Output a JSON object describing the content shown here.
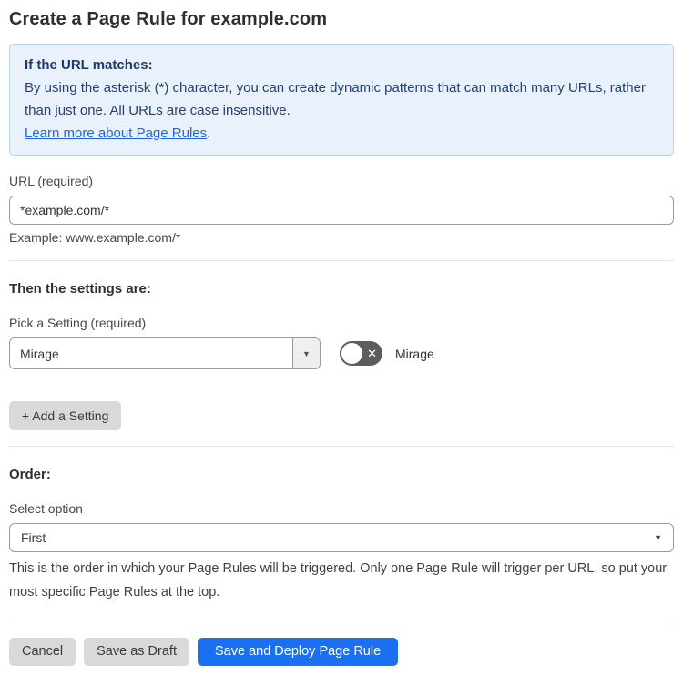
{
  "page": {
    "title": "Create a Page Rule for example.com"
  },
  "info_box": {
    "heading": "If the URL matches:",
    "body": "By using the asterisk (*) character, you can create dynamic patterns that can match many URLs, rather than just one. All URLs are case insensitive.",
    "link_label": "Learn more about Page Rules",
    "link_suffix": "."
  },
  "url_field": {
    "label": "URL (required)",
    "value": "*example.com/*",
    "helper": "Example: www.example.com/*"
  },
  "settings_section": {
    "heading": "Then the settings are:",
    "picker_label": "Pick a Setting (required)",
    "picker_value": "Mirage",
    "toggle_label": "Mirage",
    "toggle_state": "off",
    "add_setting_label": "+ Add a Setting"
  },
  "order_section": {
    "heading": "Order:",
    "select_label": "Select option",
    "select_value": "First",
    "helper": "This is the order in which your Page Rules will be triggered. Only one Page Rule will trigger per URL, so put your most specific Page Rules at the top."
  },
  "footer": {
    "cancel_label": "Cancel",
    "save_draft_label": "Save as Draft",
    "save_deploy_label": "Save and Deploy Page Rule"
  },
  "icons": {
    "combobox_caret": "▼",
    "select_caret": "▼",
    "toggle_x": "✕"
  },
  "colors": {
    "accent_blue": "#1b6ff2",
    "info_background": "#e9f2fc",
    "info_border": "#b3d3f0",
    "info_text": "#27406e",
    "link_blue": "#2264e0",
    "toggle_off_gray": "#5d5d5d",
    "button_gray": "#d9d9d9"
  }
}
